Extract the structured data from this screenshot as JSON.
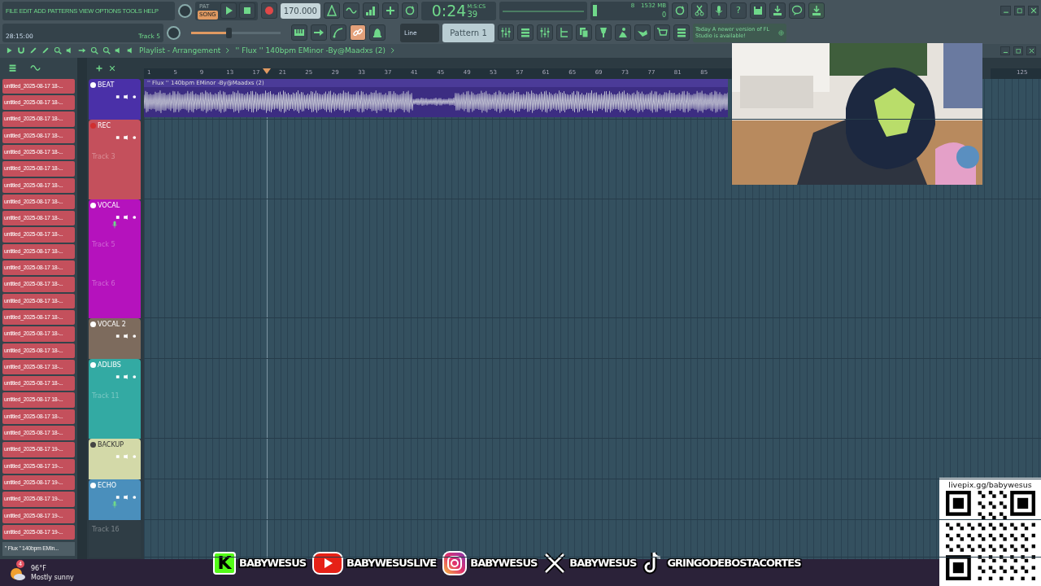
{
  "menu": [
    "FILE",
    "EDIT",
    "ADD",
    "PATTERNS",
    "VIEW",
    "OPTIONS",
    "TOOLS",
    "HELP"
  ],
  "mode_switch": [
    {
      "label": "PAT",
      "selected": false
    },
    {
      "label": "SONG",
      "selected": true
    }
  ],
  "tempo": "170.000",
  "time": {
    "value": "0:24",
    "fraction": "39",
    "unit": "M:S:CS"
  },
  "cpu": {
    "voices": "8",
    "memory": "1532 MB",
    "polyphony": "0"
  },
  "help_button": "?",
  "hint": {
    "time": "28:15:00",
    "track": "Track 5"
  },
  "master_volume": {
    "level": 0.42
  },
  "link_tool": {
    "on": true
  },
  "snap": "Line",
  "pattern": "Pattern 1",
  "news": {
    "date": "Today",
    "text": "A newer version of FL Studio is available!"
  },
  "playlist": {
    "title": "Playlist - Arrangement",
    "song": "'' Flux '' 140bpm EMinor -By@Maadxs (2)"
  },
  "browser": {
    "items": [
      "untitled_2025-08-17 18-...",
      "untitled_2025-08-17 18-...",
      "untitled_2025-08-17 18-...",
      "untitled_2025-08-17 18-...",
      "untitled_2025-08-17 18-...",
      "untitled_2025-08-17 18-...",
      "untitled_2025-08-17 18-...",
      "untitled_2025-08-17 18-...",
      "untitled_2025-08-17 18-...",
      "untitled_2025-08-17 18-...",
      "untitled_2025-08-17 18-...",
      "untitled_2025-08-17 18-...",
      "untitled_2025-08-17 18-...",
      "untitled_2025-08-17 18-...",
      "untitled_2025-08-17 18-...",
      "untitled_2025-08-17 18-...",
      "untitled_2025-08-17 18-...",
      "untitled_2025-08-17 18-...",
      "untitled_2025-08-17 18-...",
      "untitled_2025-08-17 18-...",
      "untitled_2025-08-17 18-...",
      "untitled_2025-08-17 18-...",
      "untitled_2025-08-17 19-...",
      "untitled_2025-08-17 19-...",
      "untitled_2025-08-17 19-...",
      "untitled_2025-08-17 19-...",
      "untitled_2025-08-17 19-...",
      "untitled_2025-08-17 19-..."
    ],
    "footer": "'' Flux '' 140bpm EMin..."
  },
  "ruler": [
    "1",
    "5",
    "9",
    "13",
    "17",
    "21",
    "25",
    "29",
    "33",
    "37",
    "41",
    "45",
    "49",
    "53",
    "57",
    "61",
    "65",
    "69",
    "73",
    "77",
    "81",
    "85",
    "125"
  ],
  "tracks": [
    {
      "kind": "group",
      "name": "BEAT",
      "color": "#4a30a8",
      "armed": false,
      "mic": false,
      "clips": [
        {
          "label": "'' Flux '' 140bpm EMinor -By@Maadxs (2)"
        }
      ]
    },
    {
      "kind": "group",
      "name": "REC",
      "color": "#c4505c",
      "armed": true,
      "mic": false,
      "subtracks": [
        "Track 3"
      ]
    },
    {
      "kind": "group",
      "name": "VOCAL",
      "color": "#b512bd",
      "armed": false,
      "mic": true,
      "subtracks": [
        "Track 5",
        "Track 6"
      ]
    },
    {
      "kind": "group",
      "name": "VOCAL 2",
      "color": "#7d6b5d",
      "armed": false,
      "mic": false
    },
    {
      "kind": "group",
      "name": "ADLIBS",
      "color": "#33aaa3",
      "armed": false,
      "mic": false,
      "subtracks": [
        "Track 11"
      ]
    },
    {
      "kind": "group",
      "name": "BACKUP",
      "color": "#d3d9a8",
      "armed": false,
      "mic": false
    },
    {
      "kind": "group",
      "name": "ECHO",
      "color": "#4a8fbc",
      "armed": false,
      "mic": true
    },
    {
      "kind": "empty",
      "name": "Track 16",
      "color": "#2f3d45"
    }
  ],
  "overlay": {
    "qr_caption": "livepix.gg/babywesus",
    "socials": [
      {
        "kind": "kick",
        "logo": "K",
        "handle": "BABYWESUS"
      },
      {
        "kind": "youtube",
        "handle": "BABYWESUSLIVE"
      },
      {
        "kind": "instagram",
        "handle": "BABYWESUS"
      },
      {
        "kind": "x",
        "handle": "BABYWESUS"
      },
      {
        "kind": "tiktok",
        "handle": "GRINGODEBOSTACORTES"
      }
    ]
  },
  "taskbar": {
    "weather": {
      "badge": "4",
      "temperature": "96°F",
      "condition": "Mostly sunny"
    }
  }
}
